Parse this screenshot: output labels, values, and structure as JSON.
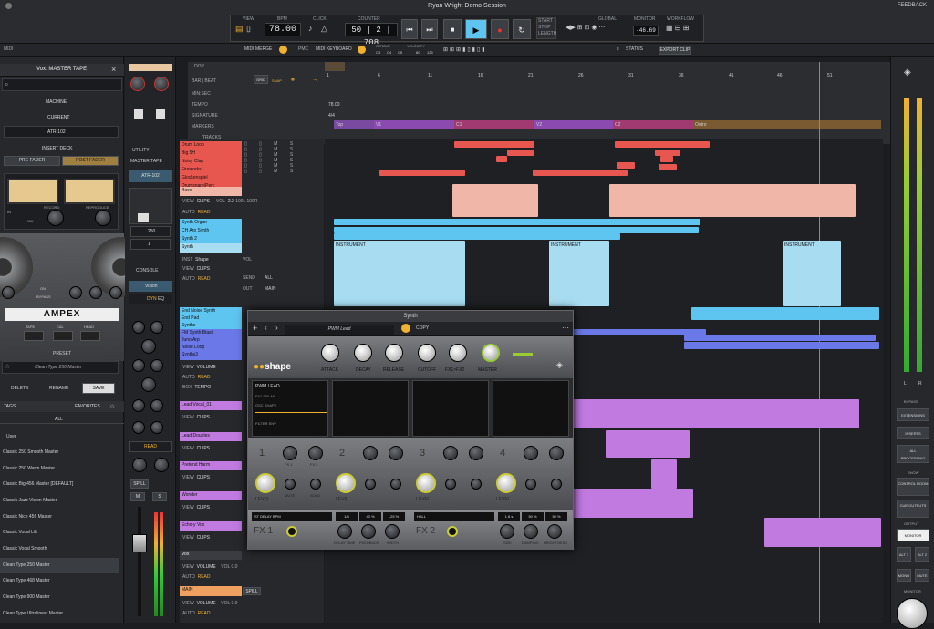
{
  "window": {
    "title": "Ryan Wright Demo Session",
    "feedback": "FEEDBACK"
  },
  "transport": {
    "view_label": "VIEW",
    "bpm_label": "BPM",
    "click_label": "CLICK",
    "counter_label": "COUNTER",
    "bpm": "78.00",
    "counter": "50 | 2 | 708",
    "start": "START",
    "stop": "STOP",
    "length": "LENGTH",
    "global_label": "GLOBAL",
    "monitor_label": "MONITOR",
    "workflow_label": "WORKFLOW",
    "monitor_value": "-46.69"
  },
  "subbar": {
    "midi": "MIDI",
    "midi_merge": "MIDI MERGE",
    "midi_keyboard": "MIDI KEYBOARD",
    "pmc": "PMC",
    "octave_label": "OCTAVE",
    "velocity_label": "VELOCITY",
    "octave_vals": [
      "C3",
      "C4",
      "C5"
    ],
    "velocity_vals": [
      "80",
      "125"
    ],
    "status": "STATUS",
    "export": "EXPORT CLIP"
  },
  "left_panel": {
    "title": "Vox: MASTER TAPE",
    "machine": "MACHINE",
    "current": "CURRENT",
    "current_value": "ATR-102",
    "insert_deck": "INSERT DECK",
    "pre_fader": "PRE-FADER",
    "post_fader": "POST-FADER",
    "record": "RECORD",
    "reproduce": "REPRODUCE",
    "in": "IN",
    "link": "LINK",
    "brand": "AMPEX",
    "bypass": "BYPASS",
    "on": "ON",
    "tape": "TAPE",
    "cal": "CAL",
    "head": "HEAD",
    "preset_label": "PRESET",
    "preset_value": "Clean Type 250 Master",
    "delete": "DELETE",
    "rename": "RENAME",
    "save": "SAVE",
    "tags": "TAGS",
    "favorites": "FAVORITES",
    "all": "ALL",
    "user": "User",
    "presets": [
      "Classic 250 Smooth Master",
      "Classic 250 Warm Master",
      "Classic Big 456 Master [DEFAULT]",
      "Classic Jazz Vision Master",
      "Classic Nice 456 Master",
      "Classic Vocal Lift",
      "Classic Vocal Smooth",
      "Clean Type 250 Master",
      "Clean Type 468 Master",
      "Clean Type 900 Master",
      "Clean Type Ultralinear Master"
    ]
  },
  "strip": {
    "utility": "UTILITY",
    "master_tape": "MASTER TAPE",
    "atr": "ATR-102",
    "console": "CONSOLE",
    "vision": "Vision",
    "dyn": "DYN",
    "eq": "EQ",
    "read": "READ",
    "spill": "SPILL",
    "mute": "M",
    "solo": "S",
    "val1": "250",
    "val2": "1"
  },
  "timeline": {
    "loop": "LOOP",
    "bar_beat": "BAR | BEAT",
    "min_sec": "MIN:SEC",
    "tempo": "TEMPO",
    "tempo_value": "78.00",
    "signature": "SIGNATURE",
    "signature_value": "4/4",
    "markers": "MARKERS",
    "tracks": "TRACKS",
    "grid": "GRID",
    "snap": "SNAP",
    "bars": [
      "1",
      "6",
      "11",
      "16",
      "21",
      "26",
      "31",
      "36",
      "41",
      "46",
      "51"
    ],
    "marker_names": [
      "Top",
      "V1",
      "C1",
      "V2",
      "C2",
      "Outro"
    ]
  },
  "tracks": {
    "drums": [
      "Drum Loop",
      "Big 5H",
      "Noisy Clap",
      "Fireworks",
      "Glockenspiel",
      "Drumsnare/Perc"
    ],
    "bass": "Bass",
    "synth_organ": "Synth Organ",
    "ch_arp": "CH Arp Synth",
    "synth2": "Synth 2",
    "synth": "Synth",
    "end_noise": "End Noise Synth",
    "end_pad": "End Pad",
    "synths": "Synths",
    "fm_synth": "FM Synth Blast",
    "juno": "Juno Arp",
    "noise_loop": "Noise Loop",
    "synths3": "Synths3",
    "lead_vocal": "Lead Vocal_01",
    "lead_doubles": "Lead Doubles",
    "pretend": "Pretend Harm",
    "wonder": "Wonder",
    "echo_vox": "Echo-y Vox",
    "vox": "Vox",
    "main": "MAIN",
    "view": "VIEW",
    "clips": "CLIPS",
    "volume": "VOLUME",
    "auto": "AUTO",
    "read": "READ",
    "tempo": "TEMPO",
    "vol": "VOL",
    "vol_val": "-2.2",
    "l100": "100L",
    "r100": "100R",
    "zero": "0.0",
    "sends": "SEND",
    "all": "ALL",
    "out": "OUT",
    "main_out": "MAIN",
    "instrument": "INSTRUMENT",
    "inst": "INST",
    "shape": "Shape",
    "spill": "SPILL"
  },
  "synth": {
    "title": "Synth",
    "preset": "PWM Lead",
    "copy": "COPY",
    "logo": "shape",
    "knobs": [
      "ATTACK",
      "DECAY",
      "RELEASE",
      "CUTOFF",
      "FX1>FX2",
      "MASTER"
    ],
    "slot1": "PWM LEAD",
    "slot_lines": [
      "FX1 DELAY",
      "OSC SHAPE",
      "FILTER ENV"
    ],
    "layer_nums": [
      "1",
      "2",
      "3",
      "4"
    ],
    "fx1": "FX 1",
    "fx2": "FX 2",
    "mute": "MUTE",
    "solo": "SOLO",
    "level": "LEVEL",
    "fx1_name": "ST DELAY BPM",
    "fx2_name": "HALL",
    "fx1_vals": [
      "1/8",
      "40 %",
      "-25 %"
    ],
    "fx2_vals": [
      "1.6 s",
      "50 %",
      "50 %"
    ],
    "fx1_knobs": [
      "DELAY TIME",
      "FEEDBACK",
      "WIDTH"
    ],
    "fx2_knobs": [
      "SIZE",
      "DAMPING",
      "BRIGHTNESS"
    ]
  },
  "right_panel": {
    "bypass": "BYPASS",
    "extensions": "EXTENSIONS",
    "inserts": "INSERTS",
    "all_processing": "ALL PROCESSING",
    "show": "SHOW",
    "control_room": "CONTROL ROOM",
    "cue_outputs": "CUE OUTPUTS",
    "output": "OUTPUT",
    "monitor": "MONITOR",
    "alt1": "ALT 1",
    "alt2": "ALT 2",
    "mono": "MONO",
    "mute": "MUTE",
    "l": "L",
    "r": "R"
  }
}
